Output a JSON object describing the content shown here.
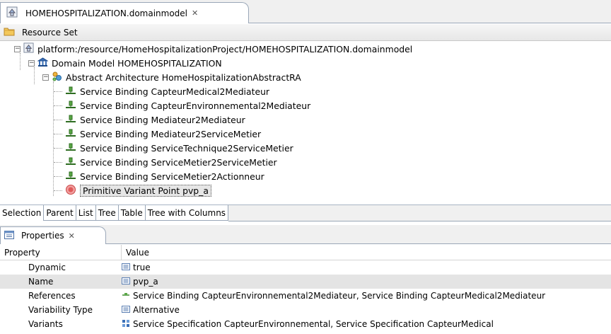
{
  "editor": {
    "tab_title": "HOMEHOSPITALIZATION.domainmodel",
    "tab_close": "✕"
  },
  "resource_set": {
    "label": "Resource Set"
  },
  "tree": {
    "root": "platform:/resource/HomeHospitalizationProject/HOMEHOSPITALIZATION.domainmodel",
    "domain_model": "Domain Model HOMEHOSPITALIZATION",
    "architecture": "Abstract Architecture HomeHospitalizationAbstractRA",
    "bindings": [
      "Service Binding CapteurMedical2Mediateur",
      "Service Binding CapteurEnvironnemental2Mediateur",
      "Service Binding Mediateur2Mediateur",
      "Service Binding Mediateur2ServiceMetier",
      "Service Binding ServiceTechnique2ServiceMetier",
      "Service Binding ServiceMetier2ServiceMetier",
      "Service Binding ServiceMetier2Actionneur"
    ],
    "variant_point": "Primitive Variant Point pvp_a"
  },
  "view_tabs": [
    "Selection",
    "Parent",
    "List",
    "Tree",
    "Table",
    "Tree with Columns"
  ],
  "properties": {
    "tab_title": "Properties",
    "tab_close": "✕",
    "col_property": "Property",
    "col_value": "Value",
    "rows": [
      {
        "name": "Dynamic",
        "value": "true",
        "icon": "text-value-icon"
      },
      {
        "name": "Name",
        "value": "pvp_a",
        "icon": "text-value-icon"
      },
      {
        "name": "References",
        "value": "Service Binding CapteurEnvironnemental2Mediateur, Service Binding CapteurMedical2Mediateur",
        "icon": "binding-icon"
      },
      {
        "name": "Variability Type",
        "value": "Alternative",
        "icon": "text-value-icon"
      },
      {
        "name": "Variants",
        "value": "Service Specification CapteurEnvironnemental, Service Specification CapteurMedical",
        "icon": "service-spec-icon"
      }
    ]
  },
  "colors": {
    "tab_border": "#9aa7b8",
    "selection_bg": "#e4e4e4",
    "variant_point_red": "#e05a5a",
    "binding_green": "#3c8a2e"
  }
}
